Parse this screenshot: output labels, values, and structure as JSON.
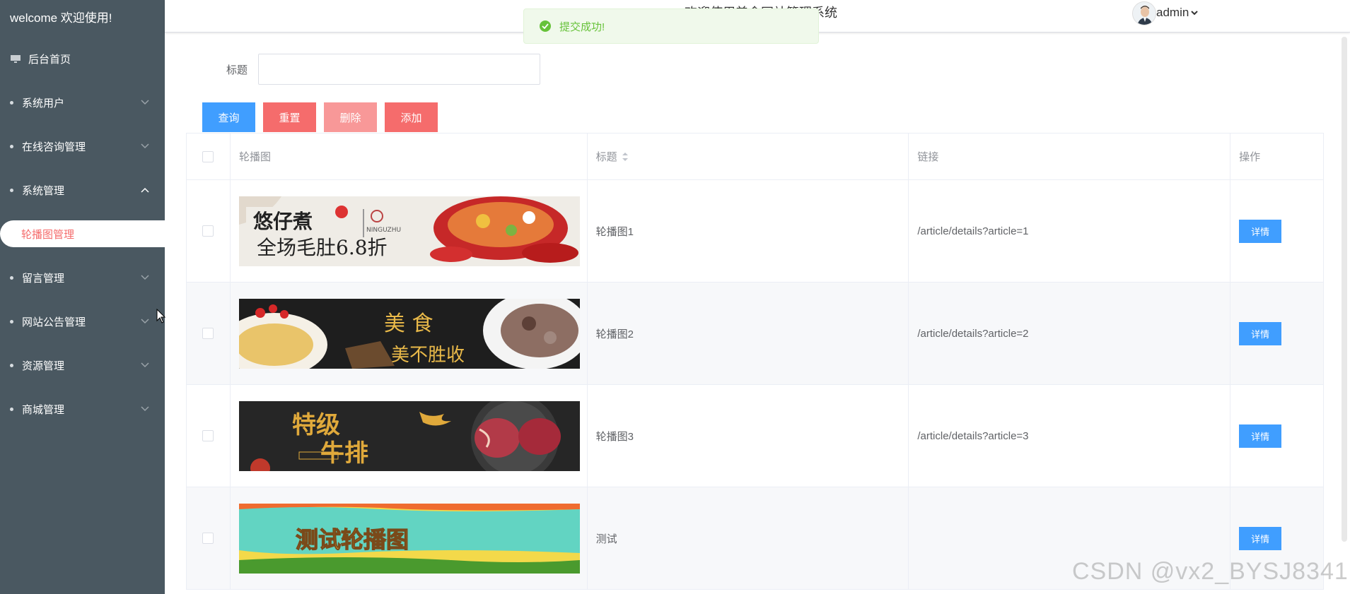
{
  "sidebar": {
    "welcome": "welcome 欢迎使用!",
    "items": [
      {
        "label": "后台首页",
        "icon": "monitor-icon"
      },
      {
        "label": "系统用户",
        "expanded": false
      },
      {
        "label": "在线咨询管理",
        "expanded": false
      },
      {
        "label": "系统管理",
        "expanded": true
      },
      {
        "label": "轮播图管理",
        "active": true
      },
      {
        "label": "留言管理",
        "expanded": false
      },
      {
        "label": "网站公告管理",
        "expanded": false
      },
      {
        "label": "资源管理",
        "expanded": false
      },
      {
        "label": "商城管理",
        "expanded": false
      }
    ]
  },
  "header": {
    "title": "欢迎使用美食网站管理系统",
    "user": "admin"
  },
  "toast": {
    "message": "提交成功!",
    "type": "success"
  },
  "search": {
    "label": "标题",
    "value": "",
    "placeholder": ""
  },
  "toolbar": {
    "query": "查询",
    "reset": "重置",
    "delete": "删除",
    "add": "添加"
  },
  "table": {
    "columns": [
      "轮播图",
      "标题",
      "链接",
      "操作"
    ],
    "rows": [
      {
        "title": "轮播图1",
        "link": "/article/details?article=1",
        "action": "详情",
        "image": "hotpot-promo-banner"
      },
      {
        "title": "轮播图2",
        "link": "/article/details?article=2",
        "action": "详情",
        "image": "food-banner-dark"
      },
      {
        "title": "轮播图3",
        "link": "/article/details?article=3",
        "action": "详情",
        "image": "steak-banner"
      },
      {
        "title": "测试",
        "link": "",
        "action": "详情",
        "image": "test-banner"
      }
    ]
  },
  "colors": {
    "sidebar_bg": "#4a5861",
    "primary": "#409eff",
    "danger": "#f56c6c",
    "danger_light": "#f89898",
    "success": "#67c23a"
  },
  "watermark": "CSDN @vx2_BYSJ8341"
}
